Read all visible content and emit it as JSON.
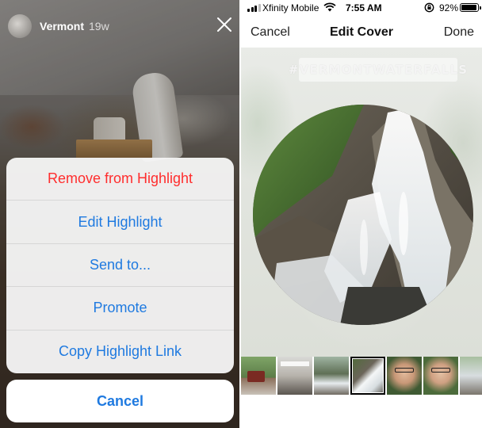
{
  "story": {
    "username": "Vermont",
    "age": "19w"
  },
  "action_sheet": {
    "items": [
      {
        "label": "Remove from Highlight",
        "style": "destructive"
      },
      {
        "label": "Edit Highlight",
        "style": "default"
      },
      {
        "label": "Send to...",
        "style": "default"
      },
      {
        "label": "Promote",
        "style": "default"
      },
      {
        "label": "Copy Highlight Link",
        "style": "default"
      }
    ],
    "cancel_label": "Cancel"
  },
  "status_bar": {
    "carrier": "Xfinity Mobile",
    "time": "7:55 AM",
    "battery": "92%",
    "battery_level": 0.92
  },
  "nav": {
    "left": "Cancel",
    "title": "Edit Cover",
    "right": "Done"
  },
  "cover": {
    "tag": "#VERMONTWATERFALLS"
  },
  "filmstrip": {
    "selected_index": 3,
    "count": 7
  },
  "colors": {
    "ios_blue": "#1f7ae0",
    "destructive_red": "#ff2d2d"
  }
}
